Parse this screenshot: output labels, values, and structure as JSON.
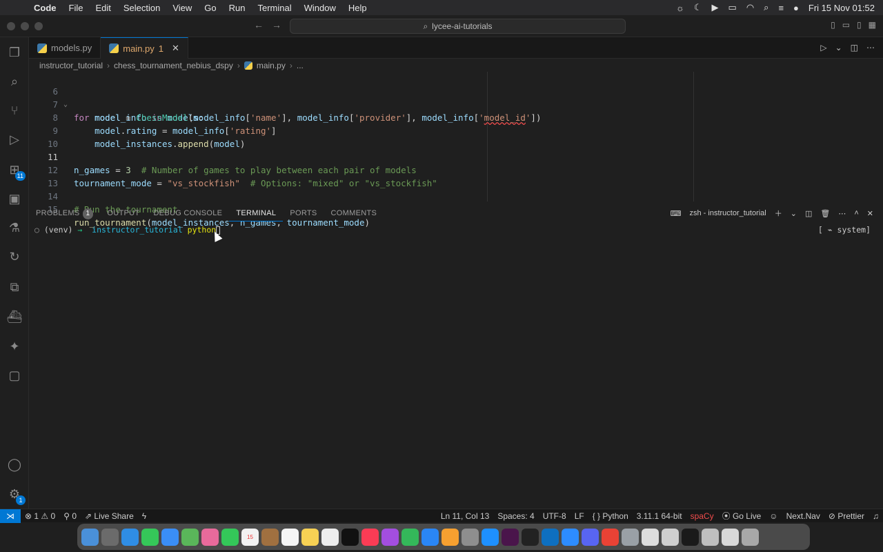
{
  "menubar": {
    "app": "Code",
    "items": [
      "File",
      "Edit",
      "Selection",
      "View",
      "Go",
      "Run",
      "Terminal",
      "Window",
      "Help"
    ],
    "datetime": "Fri 15 Nov  01:52"
  },
  "title": {
    "search": "lycee-ai-tutorials"
  },
  "activity": {
    "extensions_badge": "11",
    "settings_badge": "1"
  },
  "tabs": [
    {
      "label": "models.py"
    },
    {
      "label": "main.py",
      "problems": "1"
    }
  ],
  "breadcrumb": [
    "instructor_tutorial",
    "chess_tournament_nebius_dspy",
    "main.py",
    "..."
  ],
  "code": {
    "lines": [
      {
        "n": "6"
      },
      {
        "n": "7"
      },
      {
        "n": "8"
      },
      {
        "n": "9"
      },
      {
        "n": "10"
      },
      {
        "n": "11"
      },
      {
        "n": "12"
      },
      {
        "n": "13"
      },
      {
        "n": "14"
      },
      {
        "n": "15"
      }
    ]
  },
  "panel": {
    "tabs": [
      "PROBLEMS",
      "OUTPUT",
      "DEBUG CONSOLE",
      "TERMINAL",
      "PORTS",
      "COMMENTS"
    ],
    "problems_count": "1",
    "active_tab": "TERMINAL",
    "terminal_name": "zsh - instructor_tutorial"
  },
  "terminal": {
    "venv": "(venv)",
    "arrow": "→",
    "dir": "instructor_tutorial",
    "cmd": "python",
    "system": "system]"
  },
  "status": {
    "errors": "1",
    "warnings": "0",
    "ports": "0",
    "live_share": "Live Share",
    "position": "Ln 11, Col 13",
    "spaces": "Spaces: 4",
    "encoding": "UTF-8",
    "eol": "LF",
    "language": "Python",
    "interpreter": "3.11.1 64-bit",
    "spacy": "spaCy",
    "go_live": "Go Live",
    "next_nav": "Next.Nav",
    "prettier": "Prettier"
  },
  "colors": {
    "accent": "#0078d4",
    "error": "#f14c4c",
    "tab_active_text": "#e0a96d"
  }
}
